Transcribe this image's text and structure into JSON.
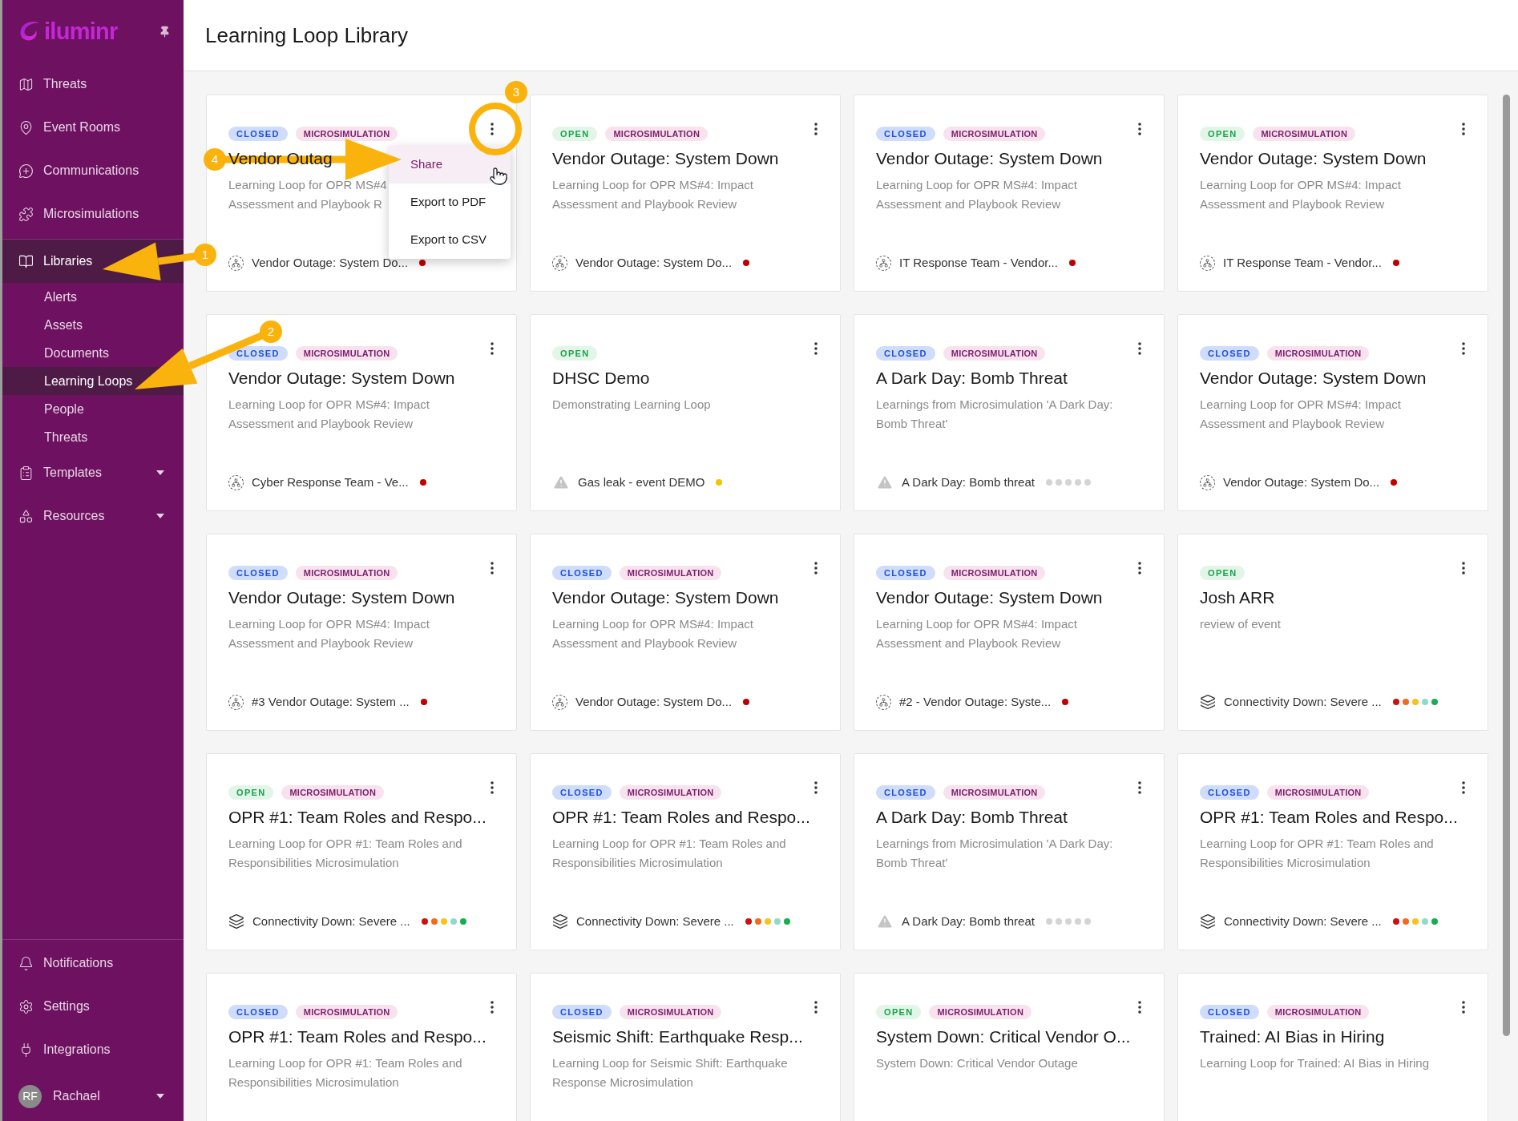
{
  "sidebar": {
    "logo": "iluminr",
    "items": [
      {
        "label": "Threats",
        "selected": false
      },
      {
        "label": "Event Rooms",
        "selected": false
      },
      {
        "label": "Communications",
        "selected": false
      },
      {
        "label": "Microsimulations",
        "selected": false
      },
      {
        "label": "Libraries",
        "selected": true,
        "expanded": true,
        "children": [
          {
            "label": "Alerts",
            "selected": false
          },
          {
            "label": "Assets",
            "selected": false
          },
          {
            "label": "Documents",
            "selected": false
          },
          {
            "label": "Learning Loops",
            "selected": true
          },
          {
            "label": "People",
            "selected": false
          },
          {
            "label": "Threats",
            "selected": false
          }
        ]
      },
      {
        "label": "Templates",
        "selected": false,
        "expanded": false
      },
      {
        "label": "Resources",
        "selected": false,
        "expanded": false
      }
    ],
    "footer_items": [
      {
        "label": "Notifications"
      },
      {
        "label": "Settings"
      },
      {
        "label": "Integrations"
      }
    ],
    "user": {
      "initials": "RF",
      "name": "Rachael"
    }
  },
  "page_title": "Learning Loop Library",
  "cards": [
    {
      "tags": [
        {
          "label": "CLOSED",
          "kind": "closed"
        },
        {
          "label": "MICROSIMULATION",
          "kind": "type"
        }
      ],
      "title": "Vendor Outag",
      "description_lines": [
        "Learning Loop for OPR MS#4",
        "Assessment and Playbook R"
      ],
      "footer": {
        "kind": "team",
        "text": "Vendor Outage: System Do...",
        "dots": [
          {
            "color": "#c00000"
          }
        ]
      },
      "menu": [
        {
          "label": "Share",
          "selected": true
        },
        {
          "label": "Export to PDF",
          "selected": false
        },
        {
          "label": "Export to CSV",
          "selected": false
        }
      ]
    },
    {
      "tags": [
        {
          "label": "OPEN",
          "kind": "open"
        },
        {
          "label": "MICROSIMULATION",
          "kind": "type"
        }
      ],
      "title": "Vendor Outage: System Down",
      "description": "Learning Loop for OPR MS#4: Impact Assessment and Playbook Review",
      "footer": {
        "kind": "team",
        "text": "Vendor Outage: System Do...",
        "dots": [
          {
            "color": "#c00000"
          }
        ]
      }
    },
    {
      "tags": [
        {
          "label": "CLOSED",
          "kind": "closed"
        },
        {
          "label": "MICROSIMULATION",
          "kind": "type"
        }
      ],
      "title": "Vendor Outage: System Down",
      "description": "Learning Loop for OPR MS#4: Impact Assessment and Playbook Review",
      "footer": {
        "kind": "team",
        "text": "IT Response Team - Vendor...",
        "dots": [
          {
            "color": "#c00000"
          }
        ]
      }
    },
    {
      "tags": [
        {
          "label": "OPEN",
          "kind": "open"
        },
        {
          "label": "MICROSIMULATION",
          "kind": "type"
        }
      ],
      "title": "Vendor Outage: System Down",
      "description": "Learning Loop for OPR MS#4: Impact Assessment and Playbook Review",
      "footer": {
        "kind": "team",
        "text": "IT Response Team - Vendor...",
        "dots": [
          {
            "color": "#c00000"
          }
        ]
      }
    },
    {
      "tags": [
        {
          "label": "CLOSED",
          "kind": "closed"
        },
        {
          "label": "MICROSIMULATION",
          "kind": "type"
        }
      ],
      "title": "Vendor Outage: System Down",
      "description": "Learning Loop for OPR MS#4: Impact Assessment and Playbook Review",
      "footer": {
        "kind": "team",
        "text": "Cyber Response Team - Ve...",
        "dots": [
          {
            "color": "#c00000"
          }
        ]
      }
    },
    {
      "tags": [
        {
          "label": "OPEN",
          "kind": "open"
        }
      ],
      "title": "DHSC Demo",
      "description": "Demonstrating Learning Loop",
      "footer": {
        "kind": "threat",
        "text": "Gas leak - event DEMO",
        "dots": [
          {
            "color": "#f5c400"
          }
        ]
      }
    },
    {
      "tags": [
        {
          "label": "CLOSED",
          "kind": "closed"
        },
        {
          "label": "MICROSIMULATION",
          "kind": "type"
        }
      ],
      "title": "A Dark Day: Bomb Threat",
      "description": "Learnings from Microsimulation 'A Dark Day: Bomb Threat'",
      "footer": {
        "kind": "threat",
        "text": "A Dark Day: Bomb threat",
        "dots": [
          {
            "color": "#d4d4d4"
          },
          {
            "color": "#d4d4d4"
          },
          {
            "color": "#d4d4d4"
          },
          {
            "color": "#d4d4d4"
          },
          {
            "color": "#d4d4d4"
          }
        ]
      }
    },
    {
      "tags": [
        {
          "label": "CLOSED",
          "kind": "closed"
        },
        {
          "label": "MICROSIMULATION",
          "kind": "type"
        }
      ],
      "title": "Vendor Outage: System Down",
      "description": "Learning Loop for OPR MS#4: Impact Assessment and Playbook Review",
      "footer": {
        "kind": "team",
        "text": "Vendor Outage: System Do...",
        "dots": [
          {
            "color": "#c00000"
          }
        ]
      }
    },
    {
      "tags": [
        {
          "label": "CLOSED",
          "kind": "closed"
        },
        {
          "label": "MICROSIMULATION",
          "kind": "type"
        }
      ],
      "title": "Vendor Outage: System Down",
      "description": "Learning Loop for OPR MS#4: Impact Assessment and Playbook Review",
      "footer": {
        "kind": "team",
        "text": "#3 Vendor Outage: System ...",
        "dots": [
          {
            "color": "#c00000"
          }
        ]
      }
    },
    {
      "tags": [
        {
          "label": "CLOSED",
          "kind": "closed"
        },
        {
          "label": "MICROSIMULATION",
          "kind": "type"
        }
      ],
      "title": "Vendor Outage: System Down",
      "description": "Learning Loop for OPR MS#4: Impact Assessment and Playbook Review",
      "footer": {
        "kind": "team",
        "text": "Vendor Outage: System Do...",
        "dots": [
          {
            "color": "#c00000"
          }
        ]
      }
    },
    {
      "tags": [
        {
          "label": "CLOSED",
          "kind": "closed"
        },
        {
          "label": "MICROSIMULATION",
          "kind": "type"
        }
      ],
      "title": "Vendor Outage: System Down",
      "description": "Learning Loop for OPR MS#4: Impact Assessment and Playbook Review",
      "footer": {
        "kind": "team",
        "text": "#2 - Vendor Outage: Syste...",
        "dots": [
          {
            "color": "#c00000"
          }
        ]
      }
    },
    {
      "tags": [
        {
          "label": "OPEN",
          "kind": "open"
        }
      ],
      "title": "Josh ARR",
      "description": "review of event",
      "footer": {
        "kind": "scenario",
        "text": "Connectivity Down: Severe ...",
        "dots": [
          {
            "color": "#cc1111"
          },
          {
            "color": "#f26b1d"
          },
          {
            "color": "#f7c21b"
          },
          {
            "color": "#8fdacb"
          },
          {
            "color": "#14b050"
          }
        ]
      }
    },
    {
      "tags": [
        {
          "label": "OPEN",
          "kind": "open"
        },
        {
          "label": "MICROSIMULATION",
          "kind": "type"
        }
      ],
      "title": "OPR #1: Team Roles and Respo...",
      "description": "Learning Loop for OPR #1: Team Roles and Responsibilities Microsimulation",
      "footer": {
        "kind": "scenario",
        "text": "Connectivity Down: Severe ...",
        "dots": [
          {
            "color": "#cc1111"
          },
          {
            "color": "#f26b1d"
          },
          {
            "color": "#f7c21b"
          },
          {
            "color": "#8fdacb"
          },
          {
            "color": "#14b050"
          }
        ]
      }
    },
    {
      "tags": [
        {
          "label": "CLOSED",
          "kind": "closed"
        },
        {
          "label": "MICROSIMULATION",
          "kind": "type"
        }
      ],
      "title": "OPR #1: Team Roles and Respo...",
      "description": "Learning Loop for OPR #1: Team Roles and Responsibilities Microsimulation",
      "footer": {
        "kind": "scenario",
        "text": "Connectivity Down: Severe ...",
        "dots": [
          {
            "color": "#cc1111"
          },
          {
            "color": "#f26b1d"
          },
          {
            "color": "#f7c21b"
          },
          {
            "color": "#8fdacb"
          },
          {
            "color": "#14b050"
          }
        ]
      }
    },
    {
      "tags": [
        {
          "label": "CLOSED",
          "kind": "closed"
        },
        {
          "label": "MICROSIMULATION",
          "kind": "type"
        }
      ],
      "title": "A Dark Day: Bomb Threat",
      "description": "Learnings from Microsimulation 'A Dark Day: Bomb Threat'",
      "footer": {
        "kind": "threat",
        "text": "A Dark Day: Bomb threat",
        "dots": [
          {
            "color": "#d4d4d4"
          },
          {
            "color": "#d4d4d4"
          },
          {
            "color": "#d4d4d4"
          },
          {
            "color": "#d4d4d4"
          },
          {
            "color": "#d4d4d4"
          }
        ]
      }
    },
    {
      "tags": [
        {
          "label": "CLOSED",
          "kind": "closed"
        },
        {
          "label": "MICROSIMULATION",
          "kind": "type"
        }
      ],
      "title": "OPR #1: Team Roles and Respo...",
      "description": "Learning Loop for OPR #1: Team Roles and Responsibilities Microsimulation",
      "footer": {
        "kind": "scenario",
        "text": "Connectivity Down: Severe ...",
        "dots": [
          {
            "color": "#cc1111"
          },
          {
            "color": "#f26b1d"
          },
          {
            "color": "#f7c21b"
          },
          {
            "color": "#8fdacb"
          },
          {
            "color": "#14b050"
          }
        ]
      }
    },
    {
      "tags": [
        {
          "label": "CLOSED",
          "kind": "closed"
        },
        {
          "label": "MICROSIMULATION",
          "kind": "type"
        }
      ],
      "title": "OPR #1: Team Roles and Respo...",
      "description": "Learning Loop for OPR #1: Team Roles and Responsibilities Microsimulation"
    },
    {
      "tags": [
        {
          "label": "CLOSED",
          "kind": "closed"
        },
        {
          "label": "MICROSIMULATION",
          "kind": "type"
        }
      ],
      "title": "Seismic Shift: Earthquake Resp...",
      "description": "Learning Loop for Seismic Shift: Earthquake Response Microsimulation"
    },
    {
      "tags": [
        {
          "label": "OPEN",
          "kind": "open"
        },
        {
          "label": "MICROSIMULATION",
          "kind": "type"
        }
      ],
      "title": "System Down: Critical Vendor O...",
      "description": "System Down: Critical Vendor Outage"
    },
    {
      "tags": [
        {
          "label": "CLOSED",
          "kind": "closed"
        },
        {
          "label": "MICROSIMULATION",
          "kind": "type"
        }
      ],
      "title": "Trained: AI Bias in Hiring",
      "description": "Learning Loop for Trained: AI Bias in Hiring"
    }
  ],
  "annotations": [
    {
      "number": "1"
    },
    {
      "number": "2"
    },
    {
      "number": "3"
    },
    {
      "number": "4"
    }
  ]
}
